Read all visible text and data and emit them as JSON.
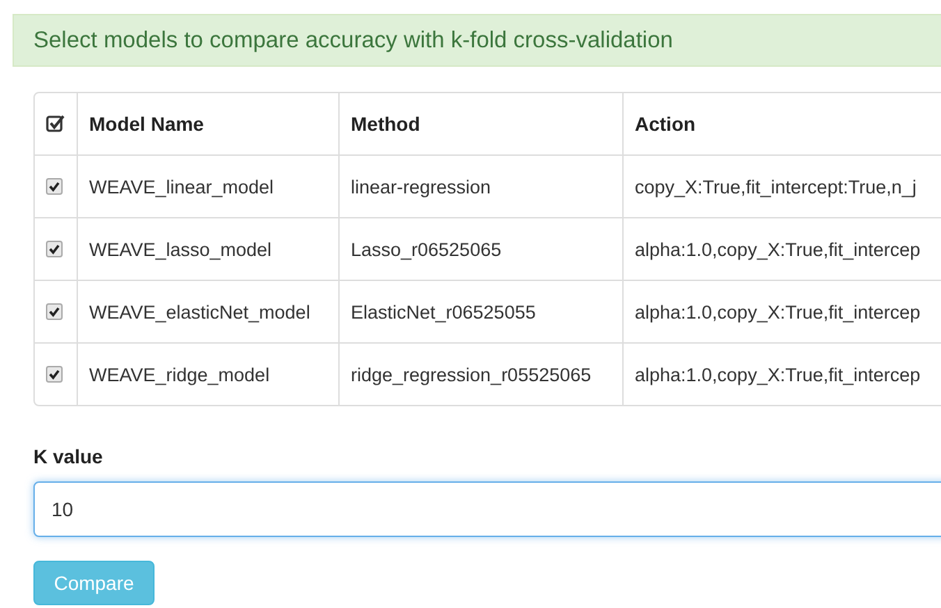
{
  "banner": {
    "text": "Select models to compare accuracy with k-fold cross-validation"
  },
  "table": {
    "select_all": {
      "checked": true
    },
    "columns": [
      "Model Name",
      "Method",
      "Action"
    ],
    "rows": [
      {
        "checked": true,
        "name": "WEAVE_linear_model",
        "method": "linear-regression",
        "action": "copy_X:True,fit_intercept:True,n_j"
      },
      {
        "checked": true,
        "name": "WEAVE_lasso_model",
        "method": "Lasso_r06525065",
        "action": "alpha:1.0,copy_X:True,fit_intercep"
      },
      {
        "checked": true,
        "name": "WEAVE_elasticNet_model",
        "method": "ElasticNet_r06525055",
        "action": "alpha:1.0,copy_X:True,fit_intercep"
      },
      {
        "checked": true,
        "name": "WEAVE_ridge_model",
        "method": "ridge_regression_r05525065",
        "action": "alpha:1.0,copy_X:True,fit_intercep"
      }
    ]
  },
  "k_field": {
    "label": "K value",
    "value": "10"
  },
  "buttons": [
    {
      "label": "Compare"
    }
  ]
}
